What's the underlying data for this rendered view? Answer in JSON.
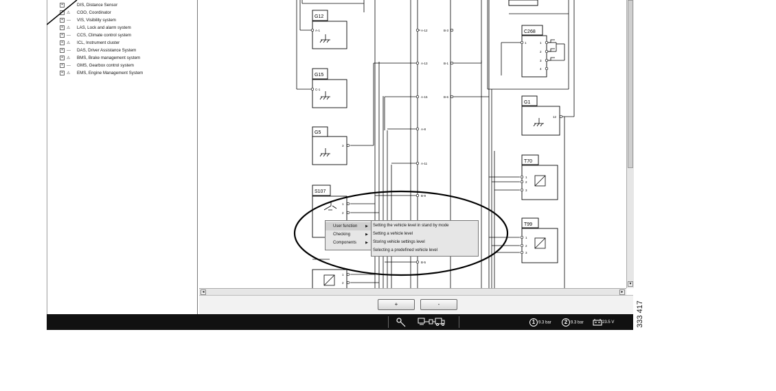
{
  "tree": {
    "items": [
      {
        "status": "",
        "label": "DIS, Distance Sensor"
      },
      {
        "status": "⚠",
        "label": "COO, Coordinator"
      },
      {
        "status": "---",
        "label": "VIS, Visibility system"
      },
      {
        "status": "⚠",
        "label": "LAS, Lock and alarm system"
      },
      {
        "status": "---",
        "label": "CCS, Climate control system"
      },
      {
        "status": "⚠",
        "label": "ICL, Instrument cluster"
      },
      {
        "status": "---",
        "label": "DAS, Driver Assistance System"
      },
      {
        "status": "⚠",
        "label": "BMS, Brake management system"
      },
      {
        "status": "---",
        "label": "GMS, Gearbox control system"
      },
      {
        "status": "⚠",
        "label": "EMS, Engine Management System"
      }
    ]
  },
  "components": {
    "g12": "G12",
    "g15": "G15",
    "g5": "G5",
    "s107": "S107",
    "c268": "C268",
    "g1": "G1",
    "t70": "T70",
    "t99": "T99"
  },
  "pins": {
    "a1": "A-1",
    "c1": "C-1",
    "g5_3": "3",
    "s107_1": "1",
    "s107_2": "2",
    "c268_1": "1",
    "c268_p1": "1",
    "c268_p2": "2",
    "c268_p3": "3",
    "c268_p4": "4",
    "g1_12": "12",
    "t70_1": "1",
    "t70_2": "2",
    "t70_3": "3",
    "t99_1": "1",
    "t99_2": "2",
    "t99_3": "3",
    "bot_1": "1",
    "bot_2": "2"
  },
  "connectors": {
    "a12": "A-12",
    "a13": "A-13",
    "a15": "A-15",
    "a8": "A-8",
    "a11": "A-11",
    "b3": "B-3",
    "b1": "B-1",
    "b6": "B-6",
    "b9": "B-9",
    "b5": "B-5"
  },
  "context_menu": {
    "items": [
      "User function",
      "Checking",
      "Components"
    ],
    "submenu": [
      "Setting the  vehicle level in stand by mode",
      "Setting a  vehicle level",
      "Storing vehicle settings level",
      "Selecting a predefined  vehicle level"
    ]
  },
  "zoom": {
    "plus": "+",
    "minus": "-"
  },
  "status": {
    "gauge1_num": "1",
    "gauge1_value": "9.3 bar",
    "gauge2_num": "2",
    "gauge2_value": "9.3 bar",
    "battery_value": "23.5 V"
  },
  "figure_number": "333 417"
}
